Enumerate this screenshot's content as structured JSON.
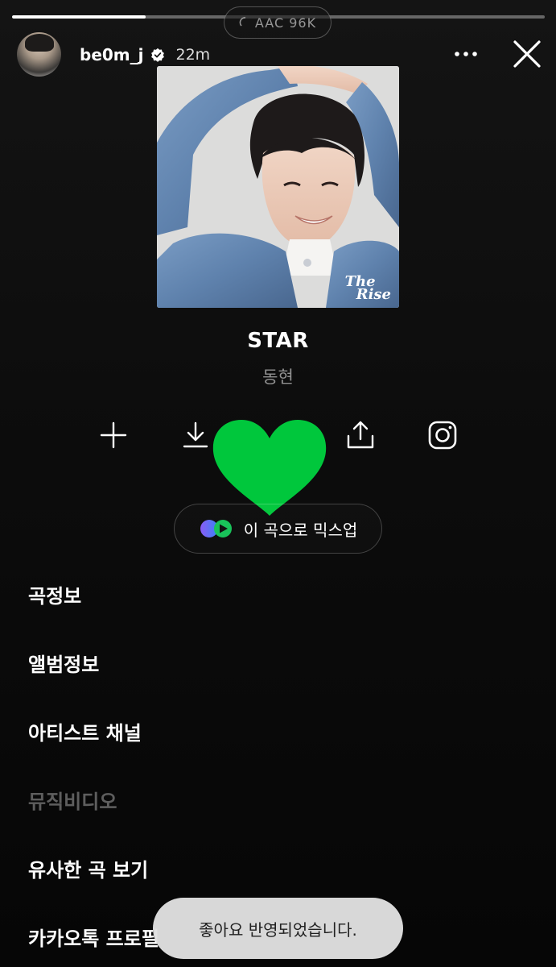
{
  "story": {
    "progress": 0.25,
    "codec_badge": "AAC 96K"
  },
  "header": {
    "username": "be0m_j",
    "time": "22m",
    "verified": true
  },
  "album": {
    "watermark_line1": "The",
    "watermark_line2": "Rise"
  },
  "song": {
    "title": "STAR",
    "artist": "동현"
  },
  "actions": [
    {
      "icon": "plus-icon"
    },
    {
      "icon": "download-icon"
    },
    {
      "icon": "share-icon"
    },
    {
      "icon": "instagram-icon"
    }
  ],
  "like_heart": {
    "color": "#00c73c"
  },
  "mixup": {
    "label": "이 곡으로 믹스업"
  },
  "menu": {
    "items": [
      {
        "label": "곡정보",
        "enabled": true
      },
      {
        "label": "앨범정보",
        "enabled": true
      },
      {
        "label": "아티스트 채널",
        "enabled": true
      },
      {
        "label": "뮤직비디오",
        "enabled": false
      },
      {
        "label": "유사한 곡 보기",
        "enabled": true
      },
      {
        "label": "카카오톡 프로필",
        "enabled": true
      }
    ]
  },
  "toast": {
    "message": "좋아요 반영되었습니다."
  },
  "colors": {
    "background": "#0c0c0c",
    "accent_green": "#00c73c",
    "toast_bg": "#e1e1e1"
  }
}
